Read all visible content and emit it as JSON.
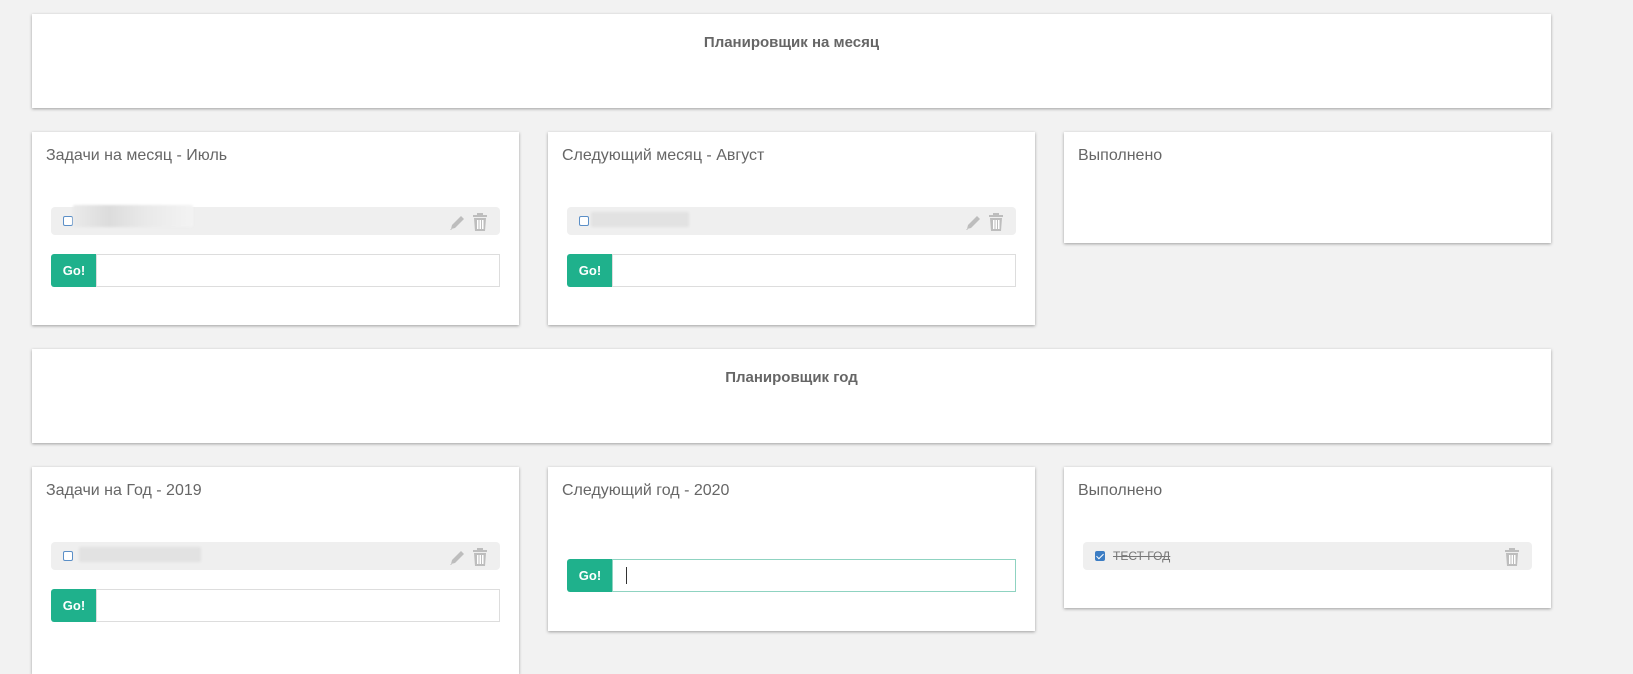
{
  "month_planner": {
    "title": "Планировщик на месяц",
    "columns": [
      {
        "title": "Задачи на месяц - Июль",
        "button": "Go!",
        "input_value": ""
      },
      {
        "title": "Следующий месяц - Август",
        "button": "Go!",
        "input_value": ""
      },
      {
        "title": "Выполнено"
      }
    ]
  },
  "year_planner": {
    "title": "Планировщик год",
    "columns": [
      {
        "title": "Задачи на Год - 2019",
        "button": "Go!",
        "input_value": ""
      },
      {
        "title": "Следующий год - 2020",
        "button": "Go!",
        "input_value": ""
      },
      {
        "title": "Выполнено",
        "tasks": [
          {
            "text": "ТЕСТ ГОД",
            "done": true
          }
        ]
      }
    ]
  },
  "icons": {
    "edit": "pencil-icon",
    "delete": "trash-icon"
  },
  "colors": {
    "go_button": "#1fb18c",
    "checkbox": "#3c7dc4",
    "background": "#f2f2f2"
  }
}
